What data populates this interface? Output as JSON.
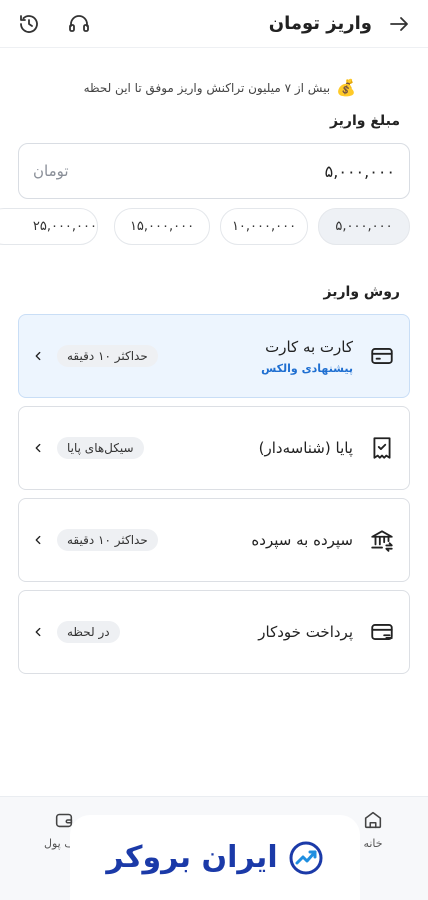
{
  "header": {
    "title": "واریز تومان"
  },
  "promo": {
    "icon": "money-bag-icon",
    "text": "بیش از ۷ میلیون تراکنش واریز موفق تا این لحظه"
  },
  "amount": {
    "label": "مبلغ واریز",
    "value": "۵,۰۰۰,۰۰۰",
    "unit": "تومان"
  },
  "chips": [
    {
      "label": "۵,۰۰۰,۰۰۰",
      "selected": true
    },
    {
      "label": "۱۰,۰۰۰,۰۰۰",
      "selected": false
    },
    {
      "label": "۱۵,۰۰۰,۰۰۰",
      "selected": false
    },
    {
      "label": "۲۵,۰۰۰,۰۰۰",
      "selected": false
    }
  ],
  "methods_label": "روش واریز",
  "methods": [
    {
      "title": "کارت به کارت",
      "subtitle": "پیشنهادی والکس",
      "badge": "حداکثر ۱۰ دقیقه",
      "icon": "credit-card-icon",
      "highlighted": true
    },
    {
      "title": "پایا (شناسه‌دار)",
      "subtitle": "",
      "badge": "سیکل‌های پایا",
      "icon": "receipt-check-icon",
      "highlighted": false
    },
    {
      "title": "سپرده به سپرده",
      "subtitle": "",
      "badge": "حداکثر ۱۰ دقیقه",
      "icon": "bank-transfer-icon",
      "highlighted": false
    },
    {
      "title": "پرداخت خودکار",
      "subtitle": "",
      "badge": "در لحظه",
      "icon": "auto-pay-card-icon",
      "highlighted": false
    }
  ],
  "nav": [
    {
      "label": "خانه",
      "icon": "home-icon"
    },
    {
      "label": "کیف پول",
      "icon": "wallet-icon"
    }
  ],
  "watermark": {
    "text": "ایران بروکر"
  },
  "colors": {
    "accent": "#1f6fd1",
    "highlight_bg": "#edf5fe",
    "watermark": "#1b3aa8"
  }
}
